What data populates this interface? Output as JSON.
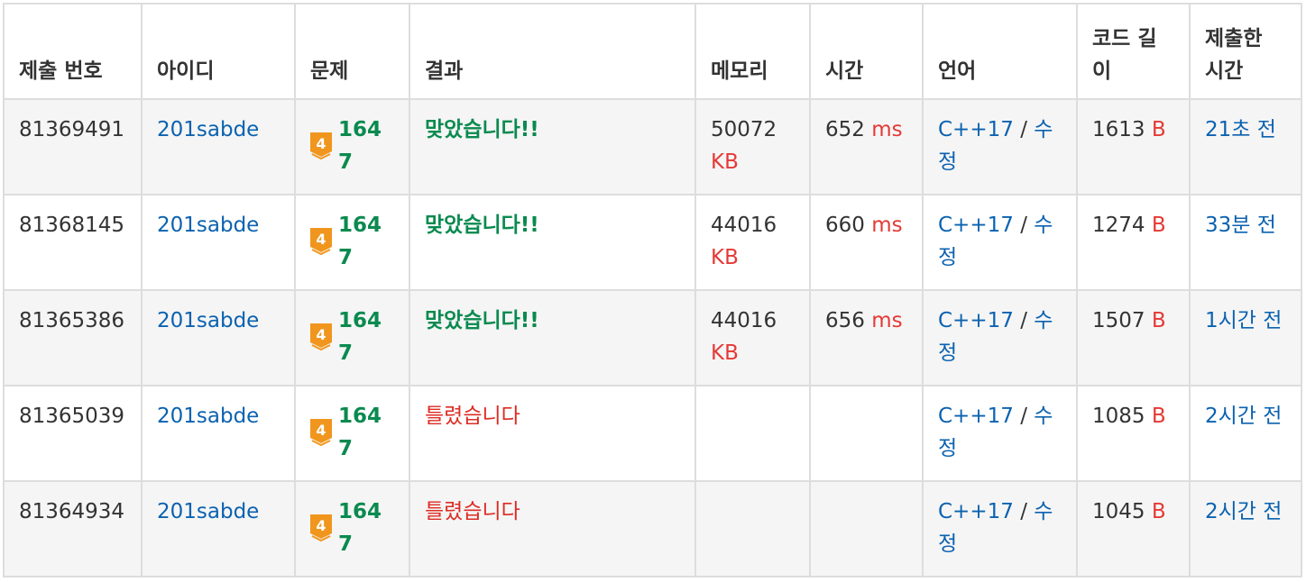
{
  "headers": {
    "submission_id": "제출 번호",
    "user": "아이디",
    "problem": "문제",
    "result": "결과",
    "memory": "메모리",
    "time": "시간",
    "language": "언어",
    "code_length": "코드 길이",
    "submitted_at": "제출한 시간"
  },
  "units": {
    "memory": "KB",
    "time": "ms",
    "length": "B"
  },
  "colors": {
    "accepted": "#0a8a4f",
    "wrong": "#dd2c24",
    "link": "#0b62b0",
    "unit": "#e53935",
    "tier_badge": "#f0961e"
  },
  "rows": [
    {
      "id": "81369491",
      "user": "201sabde",
      "tier": "4",
      "problem": "1647",
      "result": "맞았습니다!!",
      "status": "accepted",
      "memory": "50072",
      "time": "652",
      "lang": "C++17",
      "sep": "/",
      "edit": "수정",
      "length": "1613",
      "ago": "21초 전"
    },
    {
      "id": "81368145",
      "user": "201sabde",
      "tier": "4",
      "problem": "1647",
      "result": "맞았습니다!!",
      "status": "accepted",
      "memory": "44016",
      "time": "660",
      "lang": "C++17",
      "sep": "/",
      "edit": "수정",
      "length": "1274",
      "ago": "33분 전"
    },
    {
      "id": "81365386",
      "user": "201sabde",
      "tier": "4",
      "problem": "1647",
      "result": "맞았습니다!!",
      "status": "accepted",
      "memory": "44016",
      "time": "656",
      "lang": "C++17",
      "sep": "/",
      "edit": "수정",
      "length": "1507",
      "ago": "1시간 전"
    },
    {
      "id": "81365039",
      "user": "201sabde",
      "tier": "4",
      "problem": "1647",
      "result": "틀렸습니다",
      "status": "wrong",
      "memory": "",
      "time": "",
      "lang": "C++17",
      "sep": "/",
      "edit": "수정",
      "length": "1085",
      "ago": "2시간 전"
    },
    {
      "id": "81364934",
      "user": "201sabde",
      "tier": "4",
      "problem": "1647",
      "result": "틀렸습니다",
      "status": "wrong",
      "memory": "",
      "time": "",
      "lang": "C++17",
      "sep": "/",
      "edit": "수정",
      "length": "1045",
      "ago": "2시간 전"
    }
  ]
}
